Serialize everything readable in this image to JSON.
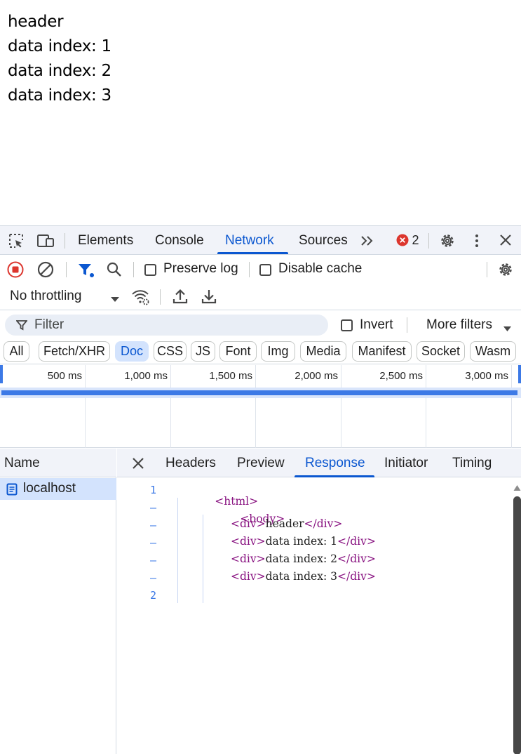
{
  "page": {
    "lines": [
      "header",
      "data index: 1",
      "data index: 2",
      "data index: 3"
    ]
  },
  "devtools": {
    "tabs": [
      "Elements",
      "Console",
      "Network",
      "Sources"
    ],
    "active_tab": "Network",
    "error_count": "2",
    "toolbar": {
      "preserve_log": "Preserve log",
      "disable_cache": "Disable cache",
      "throttling": "No throttling"
    },
    "filter": {
      "placeholder": "Filter",
      "invert": "Invert",
      "more_filters": "More filters"
    },
    "type_chips": [
      "All",
      "Fetch/XHR",
      "Doc",
      "CSS",
      "JS",
      "Font",
      "Img",
      "Media",
      "Manifest",
      "Socket",
      "Wasm"
    ],
    "active_chip": "Doc",
    "timeline_ticks": [
      "500 ms",
      "1,000 ms",
      "1,500 ms",
      "2,000 ms",
      "2,500 ms",
      "3,000 ms"
    ],
    "requests_header": "Name",
    "requests": [
      {
        "name": "localhost"
      }
    ],
    "detail_tabs": [
      "Headers",
      "Preview",
      "Response",
      "Initiator",
      "Timing"
    ],
    "active_detail_tab": "Response",
    "response": {
      "gutter": [
        "1",
        "–",
        "–",
        "–",
        "–",
        "–",
        "2"
      ],
      "lines": [
        {
          "open": "<html>",
          "text": "",
          "close": ""
        },
        {
          "open": "<body>",
          "text": "",
          "close": ""
        },
        {
          "open": "<div>",
          "text": "header",
          "close": "</div>"
        },
        {
          "open": "<div>",
          "text": "data index: 1",
          "close": "</div>"
        },
        {
          "open": "<div>",
          "text": "data index: 2",
          "close": "</div>"
        },
        {
          "open": "<div>",
          "text": "data index: 3",
          "close": "</div>"
        }
      ]
    },
    "colors": {
      "accent": "#0b57d0",
      "record_red": "#dc362e",
      "error_red": "#dc362e",
      "tag_purple": "#881280",
      "chip_active_bg": "#d3e3fd"
    }
  }
}
